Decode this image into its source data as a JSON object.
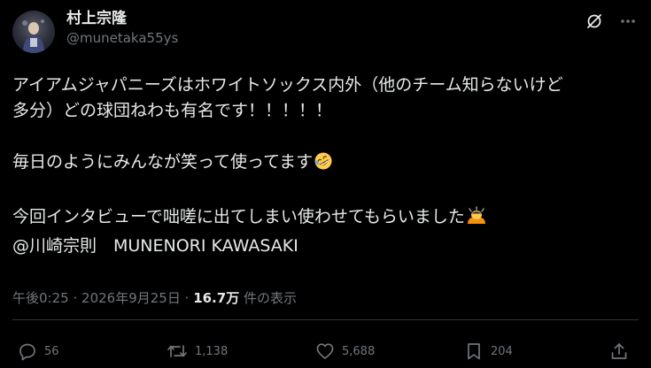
{
  "author": {
    "display_name": "村上宗隆",
    "handle": "@munetaka55ys"
  },
  "tweet": {
    "lines": [
      "アイアムジャパニーズはホワイトソックス内外（他のチーム知らないけど",
      "多分）どの球団ねわも有名です！！！！！",
      "",
      "毎日のようにみんなが笑って使ってます",
      "",
      "今回インタビューで咄嗟に出てしまい使わせてもらいました",
      "@川崎宗則　MUNENORI KAWASAKI"
    ],
    "emoji": [
      "rolling-on-floor-laughing-emoji",
      "bowing-person-emoji"
    ]
  },
  "meta": {
    "time": "午後0:25",
    "separator": "·",
    "date": "2026年9月25日",
    "views_count": "16.7万",
    "views_label": "件の表示"
  },
  "actions": {
    "reply_count": "56",
    "repost_count": "1,138",
    "like_count": "5,688",
    "bookmark_count": "204"
  },
  "colors": {
    "background": "#000000",
    "text": "#e7e9ea",
    "muted": "#71767b",
    "divider": "#2f3336"
  }
}
